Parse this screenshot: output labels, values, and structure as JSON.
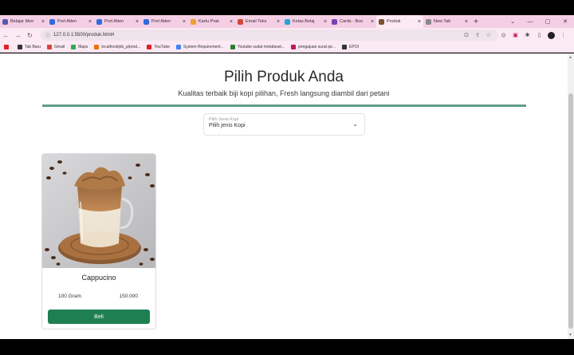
{
  "browser": {
    "tabs": [
      {
        "title": "Belajar Men",
        "color": "#5a5ab0",
        "active": false
      },
      {
        "title": "Port Atten",
        "color": "#2f6bdc",
        "active": false
      },
      {
        "title": "Port Atten",
        "color": "#2f6bdc",
        "active": false
      },
      {
        "title": "Port Atten",
        "color": "#2f6bdc",
        "active": false
      },
      {
        "title": "Kartu Prak",
        "color": "#f0a030",
        "active": false
      },
      {
        "title": "Email Teks",
        "color": "#d44638",
        "active": false
      },
      {
        "title": "Kelas Belaj",
        "color": "#2aa0d8",
        "active": false
      },
      {
        "title": "Cards - Boo",
        "color": "#7b3fb8",
        "active": false
      },
      {
        "title": "Produk",
        "color": "#7a5230",
        "active": true
      },
      {
        "title": "New Tab",
        "color": "#888888",
        "active": false
      }
    ],
    "url": "127.0.0.1:5500/produk.html#",
    "bookmarks": [
      {
        "label": "",
        "color": "#e02020"
      },
      {
        "label": "Tab Baru",
        "color": "#333333"
      },
      {
        "label": "Gmail",
        "color": "#d44638"
      },
      {
        "label": "Maps",
        "color": "#34a853"
      },
      {
        "label": "localhost/pib_p/prod...",
        "color": "#e8710a"
      },
      {
        "label": "YouTube",
        "color": "#e02020"
      },
      {
        "label": "System Requirement...",
        "color": "#4285f4"
      },
      {
        "label": "Youtube sudut metafaset...",
        "color": "#2e7d32"
      },
      {
        "label": "pengajuan surat pe...",
        "color": "#c2185b"
      },
      {
        "label": "EPOI",
        "color": "#333333"
      }
    ]
  },
  "page": {
    "title": "Pilih Produk Anda",
    "subtitle": "Kualitas terbaik biji kopi pilihan, Fresh langsung diambil dari petani",
    "select": {
      "label": "Pilih Jenis Kopi",
      "value": "Pilih jenis Kopi"
    },
    "products": [
      {
        "name": "Cappucino",
        "weight": "100 Gram",
        "price": "150.000",
        "button": "Beli"
      }
    ]
  },
  "colors": {
    "accent": "#5f9e88",
    "button": "#1e7f53",
    "tabbar": "#f4cfe4"
  }
}
